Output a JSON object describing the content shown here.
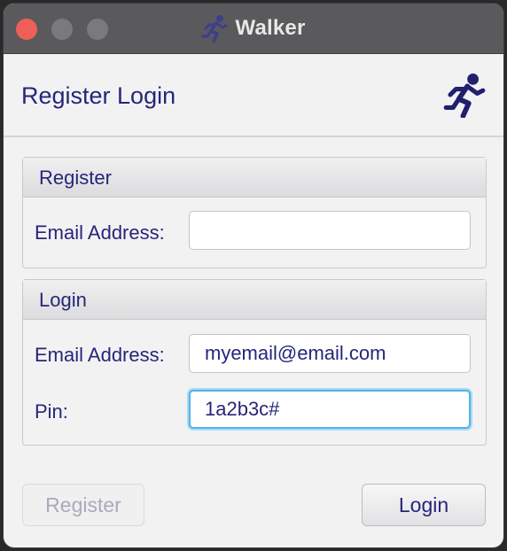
{
  "window": {
    "title": "Walker",
    "title_icon": "runner-icon"
  },
  "header": {
    "title": "Register Login",
    "icon": "runner-icon"
  },
  "register": {
    "group_title": "Register",
    "email_label": "Email Address:",
    "email_value": ""
  },
  "login": {
    "group_title": "Login",
    "email_label": "Email Address:",
    "email_value": "myemail@email.com",
    "pin_label": "Pin:",
    "pin_value": "1a2b3c#"
  },
  "buttons": {
    "register_label": "Register",
    "register_enabled": false,
    "login_label": "Login"
  },
  "colors": {
    "accent": "#26267a",
    "focus_ring": "#4fb3e6",
    "close_button": "#ed5f57",
    "titlebar": "#5a5a5c"
  }
}
